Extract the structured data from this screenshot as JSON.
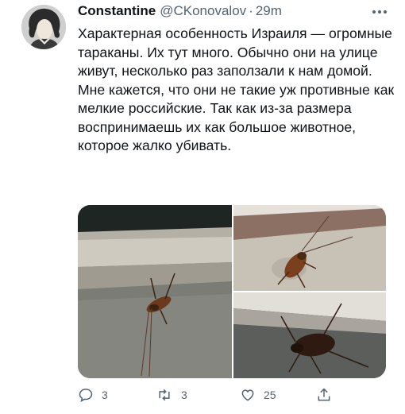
{
  "tweet": {
    "author_name": "Constantine",
    "author_handle": "@CKonovalov",
    "separator": "·",
    "time": "29m",
    "paragraph1": "Характерная особенность Израиля — огромные тараканы. Их тут много. Обычно они на улице живут, несколько раз заползали к нам домой.",
    "paragraph2": "Мне кажется, что они не такие уж противные как мелкие российские. Так как из-за размера воспринимаешь их как большое животное, которое жалко убивать.",
    "media_count": 3
  },
  "actions": {
    "reply_count": "3",
    "retweet_count": "3",
    "like_count": "25"
  },
  "icons": {
    "more": "more-dots-icon",
    "reply": "reply-bubble-icon",
    "retweet": "retweet-icon",
    "like": "heart-icon",
    "share": "share-upload-icon"
  },
  "colors": {
    "text": "#0f1419",
    "secondary": "#536471"
  }
}
